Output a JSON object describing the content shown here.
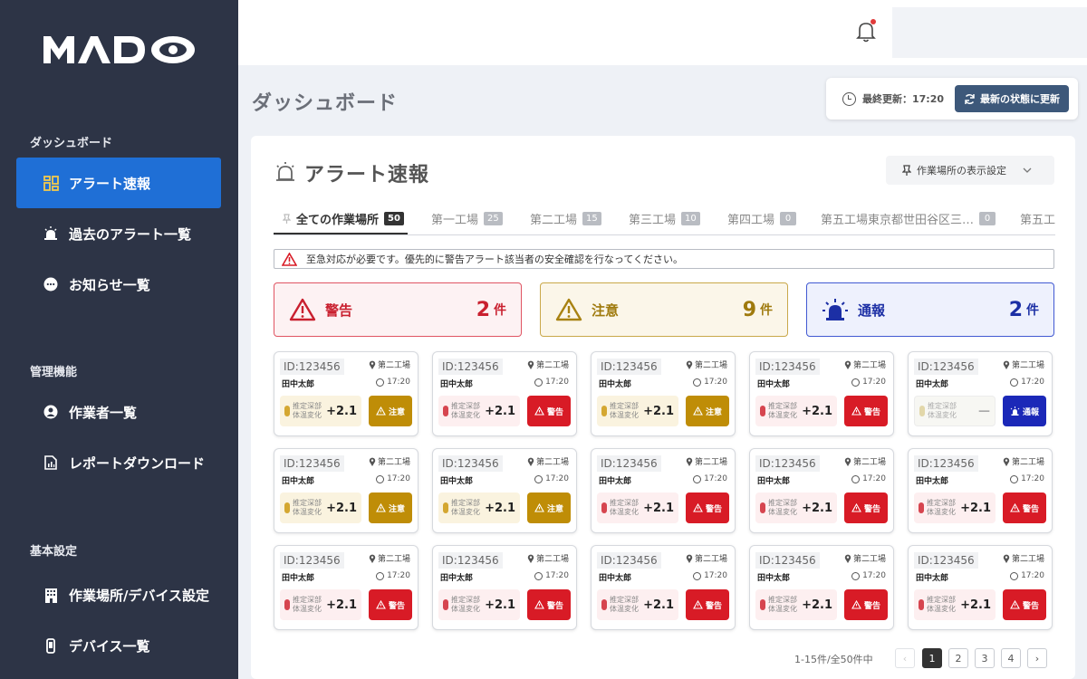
{
  "brand": {
    "logo": "MADO"
  },
  "sidebar": {
    "sections": [
      {
        "title": "ダッシュボード",
        "items": [
          {
            "label": "アラート速報",
            "icon": "grid-icon",
            "active": true
          },
          {
            "label": "過去のアラート一覧",
            "icon": "alarm-icon"
          },
          {
            "label": "お知らせ一覧",
            "icon": "chat-icon"
          }
        ]
      },
      {
        "title": "管理機能",
        "items": [
          {
            "label": "作業者一覧",
            "icon": "user-icon"
          },
          {
            "label": "レポートダウンロード",
            "icon": "report-icon"
          }
        ]
      },
      {
        "title": "基本設定",
        "items": [
          {
            "label": "作業場所/デバイス設定",
            "icon": "building-icon"
          },
          {
            "label": "デバイス一覧",
            "icon": "device-icon"
          }
        ]
      }
    ]
  },
  "header": {
    "page_title": "ダッシュボード",
    "last_update": "最終更新：17:20",
    "refresh_label": "最新の状態に更新"
  },
  "panel": {
    "title": "アラート速報",
    "display_setting": "作業場所の表示設定"
  },
  "tabs": [
    {
      "label": "全ての作業場所",
      "count": "50"
    },
    {
      "label": "第一工場",
      "count": "25"
    },
    {
      "label": "第二工場",
      "count": "15"
    },
    {
      "label": "第三工場",
      "count": "10"
    },
    {
      "label": "第四工場",
      "count": "0"
    },
    {
      "label": "第五工場東京都世田谷区三…",
      "count": "0"
    },
    {
      "label": "第五工"
    }
  ],
  "notice": "至急対応が必要です。優先的に警告アラート該当者の安全確認を行なってください。",
  "summary": {
    "warn": {
      "label": "警告",
      "count": "2",
      "unit": "件"
    },
    "caution": {
      "label": "注意",
      "count": "9",
      "unit": "件"
    },
    "info": {
      "label": "通報",
      "count": "2",
      "unit": "件"
    }
  },
  "card_common": {
    "id": "ID:123456",
    "location": "第二工場",
    "name": "田中太郎",
    "time": "17:20",
    "metric_label_1": "推定深部",
    "metric_label_2": "体温変化"
  },
  "level_labels": {
    "warn": "警告",
    "caution": "注意",
    "info": "通報"
  },
  "cards": [
    {
      "level": "caution",
      "value": "+2.1"
    },
    {
      "level": "warn",
      "value": "+2.1"
    },
    {
      "level": "caution",
      "value": "+2.1"
    },
    {
      "level": "warn",
      "value": "+2.1"
    },
    {
      "level": "info",
      "value": "—"
    },
    {
      "level": "caution",
      "value": "+2.1"
    },
    {
      "level": "caution",
      "value": "+2.1"
    },
    {
      "level": "warn",
      "value": "+2.1"
    },
    {
      "level": "warn",
      "value": "+2.1"
    },
    {
      "level": "warn",
      "value": "+2.1"
    },
    {
      "level": "warn",
      "value": "+2.1"
    },
    {
      "level": "warn",
      "value": "+2.1"
    },
    {
      "level": "warn",
      "value": "+2.1"
    },
    {
      "level": "warn",
      "value": "+2.1"
    },
    {
      "level": "warn",
      "value": "+2.1"
    }
  ],
  "pagination": {
    "summary": "1-15件/全50件中",
    "pages": [
      "1",
      "2",
      "3",
      "4"
    ],
    "prev": "‹",
    "next": "›"
  }
}
